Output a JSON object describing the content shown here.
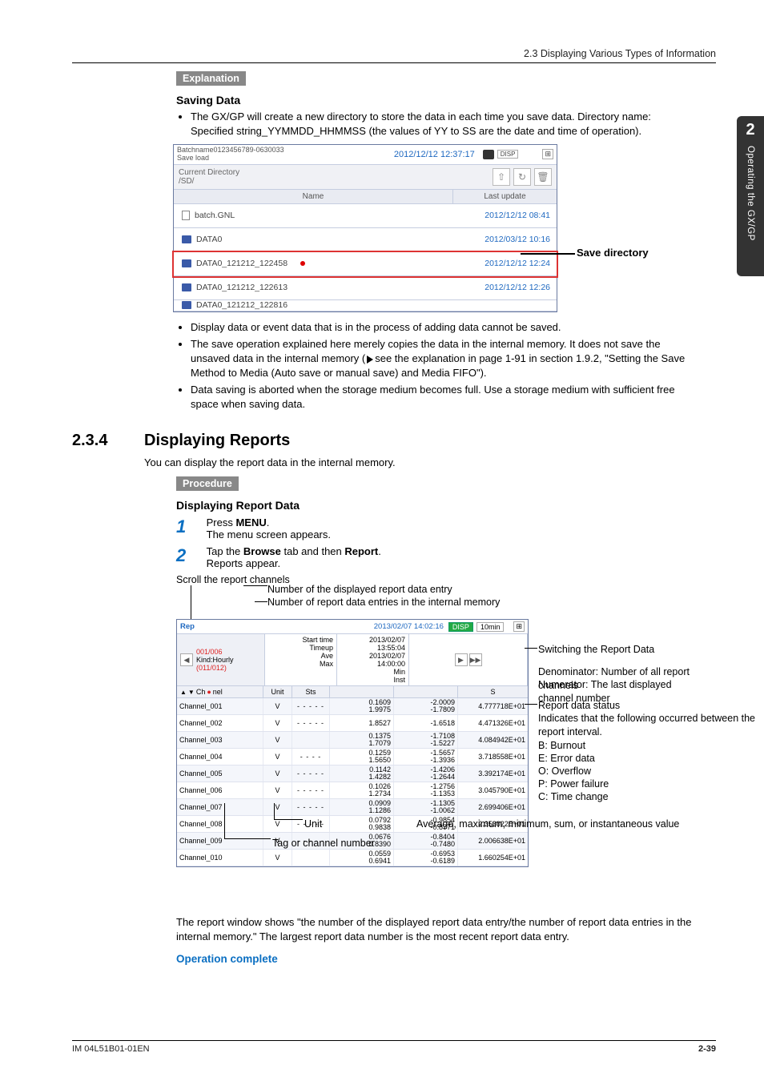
{
  "header": {
    "breadcrumb": "2.3  Displaying Various Types of Information"
  },
  "side_tab": {
    "num": "2",
    "text": "Operating the GX/GP"
  },
  "explanation": {
    "label": "Explanation",
    "saving_title": "Saving Data",
    "bullet1": "The GX/GP will create a new directory to store the data in each time you save data. Directory name: Specified string_YYMMDD_HHMMSS (the values of YY to SS are the date and time of operation).",
    "bullet2": "Display data or event data that is in the process of adding data cannot be saved.",
    "bullet3_a": "The save operation explained here merely copies the data in the internal memory. It does not save the unsaved data in the internal memory (",
    "bullet3_b": "see the explanation in page 1-91 in section 1.9.2, \"Setting the Save Method to Media (Auto save or manual save) and Media FIFO\").",
    "bullet4": "Data saving is aborted when the storage medium becomes full. Use a storage medium with sufficient free space when saving data.",
    "save_dir_label": "Save directory"
  },
  "shot1": {
    "topline1": "Batchname0123456789-0630033",
    "topline2": "Save load",
    "timestamp": "2012/12/12 12:37:17",
    "cd_label": "Current Directory",
    "cd_path": "/SD/",
    "col_name": "Name",
    "col_lu": "Last update",
    "rows": [
      {
        "name": "batch.GNL",
        "type": "file",
        "lu": "2012/12/12 08:41"
      },
      {
        "name": "DATA0",
        "type": "folder",
        "lu": "2012/03/12 10:16"
      },
      {
        "name": "DATA0_121212_122458",
        "type": "folder",
        "lu": "2012/12/12 12:24",
        "hl": true
      },
      {
        "name": "DATA0_121212_122613",
        "type": "folder",
        "lu": "2012/12/12 12:26"
      },
      {
        "name": "DATA0_121212_122816",
        "type": "folder",
        "lu": ""
      }
    ]
  },
  "section234": {
    "num": "2.3.4",
    "title": "Displaying Reports",
    "intro": "You can display the report data in the internal memory."
  },
  "procedure": {
    "label": "Procedure",
    "subtitle": "Displaying Report Data",
    "step1a": "Press ",
    "step1b": "MENU",
    "step1c": ".",
    "step1_sub": "The menu screen appears.",
    "step2a": "Tap the ",
    "step2b": "Browse",
    "step2c": " tab and then ",
    "step2d": "Report",
    "step2e": ".",
    "step2_sub": "Reports appear.",
    "scroll_label": "Scroll the report channels",
    "annot_num_disp": "Number of the displayed report data entry",
    "annot_num_entries": "Number of report data entries in the internal memory",
    "annot_switch": "Switching the Report Data",
    "annot_denom": "Denominator: Number of all report channels",
    "annot_numer": "Numerator: The last displayed channel number",
    "annot_status_t": "Report data status",
    "annot_status_s": "Indicates that the following occurred between the report interval.",
    "annot_b": "B: Burnout",
    "annot_e": "E: Error data",
    "annot_o": "O: Overflow",
    "annot_p": "P: Power failure",
    "annot_c": "C: Time change",
    "annot_unit": "Unit",
    "annot_avg": "Average, maximum, minimum, sum, or instantaneous value",
    "annot_tag": "Tag or channel number",
    "para_after": "The report window shows \"the number of the displayed report data entry/the number of report data entries in the internal memory.\" The largest report data number is the most recent report data entry.",
    "op_complete": "Operation complete"
  },
  "shot2": {
    "lbl": "Rep",
    "timestamp": "2013/02/07 14:02:16",
    "disp_badge": "DISP",
    "interval": "10min",
    "frac": "001/006",
    "kind": "Kind:Hourly",
    "chfrac": "(011/012)",
    "start_l": "Start time",
    "start_v": "2013/02/07 13:55:04",
    "timeup_l": "Timeup",
    "timeup_v": "2013/02/07 14:00:00",
    "c_ch": "Ch",
    "c_ch2": "nel",
    "c_unit": "Unit",
    "c_sts": "Sts",
    "c_ave": "Ave",
    "c_max": "Max",
    "c_min": "Min",
    "c_inst": "Inst",
    "c_sum": "S",
    "rows": [
      {
        "ch": "Channel_001",
        "u": "V",
        "s": "- - - - -",
        "a": "0.1609",
        "m": "1.9975",
        "mn": "-2.0009",
        "in": "-1.7809",
        "su": "4.777718E+01"
      },
      {
        "ch": "Channel_002",
        "u": "V",
        "s": "- - - - -",
        "a": "",
        "m": "1.8527",
        "mn": "-1.6518",
        "in": "",
        "su": "4.471326E+01"
      },
      {
        "ch": "Channel_003",
        "u": "V",
        "s": "",
        "a": "0.1375",
        "m": "1.7079",
        "mn": "-1.7108",
        "in": "-1.5227",
        "su": "4.084942E+01"
      },
      {
        "ch": "Channel_004",
        "u": "V",
        "s": "- -   - -",
        "a": "0.1259",
        "m": "1.5650",
        "mn": "-1.5657",
        "in": "-1.3936",
        "su": "3.718558E+01"
      },
      {
        "ch": "Channel_005",
        "u": "V",
        "s": "- - - - -",
        "a": "0.1142",
        "m": "1.4282",
        "mn": "-1.4206",
        "in": "-1.2644",
        "su": "3.392174E+01"
      },
      {
        "ch": "Channel_006",
        "u": "V",
        "s": "- - - - -",
        "a": "0.1026",
        "m": "1.2734",
        "mn": "-1.2756",
        "in": "-1.1353",
        "su": "3.045790E+01"
      },
      {
        "ch": "Channel_007",
        "u": "V",
        "s": "- - - - -",
        "a": "0.0909",
        "m": "1.1286",
        "mn": "-1.1305",
        "in": "-1.0062",
        "su": "2.699406E+01"
      },
      {
        "ch": "Channel_008",
        "u": "V",
        "s": "- - - - -",
        "a": "0.0792",
        "m": "0.9838",
        "mn": "-0.9854",
        "in": "-0.8771",
        "su": "2.353022E+01"
      },
      {
        "ch": "Channel_009",
        "u": "V",
        "s": "- - - - -",
        "a": "0.0676",
        "m": "0.8390",
        "mn": "-0.8404",
        "in": "-0.7480",
        "su": "2.006638E+01"
      },
      {
        "ch": "Channel_010",
        "u": "V",
        "s": "",
        "a": "0.0559",
        "m": "0.6941",
        "mn": "-0.6953",
        "in": "-0.6189",
        "su": "1.660254E+01"
      }
    ]
  },
  "footer": {
    "left": "IM 04L51B01-01EN",
    "right": "2-39"
  }
}
